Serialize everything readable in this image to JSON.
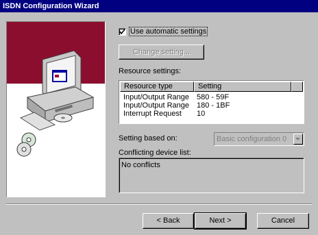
{
  "window": {
    "title": "ISDN Configuration Wizard"
  },
  "options": {
    "use_automatic": {
      "label": "Use automatic settings",
      "checked": true
    },
    "change_setting_label": "Change setting..."
  },
  "resources": {
    "section_label": "Resource settings:",
    "columns": [
      "Resource type",
      "Setting"
    ],
    "rows": [
      [
        "Input/Output Range",
        "580 - 59F"
      ],
      [
        "Input/Output Range",
        "180 - 1BF"
      ],
      [
        "Interrupt Request",
        "10"
      ]
    ]
  },
  "based_on": {
    "label": "Setting based on:",
    "value": "Basic configuration 0"
  },
  "conflicts": {
    "label": "Conflicting device list:",
    "text": "No conflicts"
  },
  "buttons": {
    "back": "< Back",
    "next": "Next >",
    "cancel": "Cancel"
  },
  "colors": {
    "titlebar": "#000080",
    "graphic_band": "#8b0e2e",
    "face": "#c0c0c0"
  },
  "icons": [
    "computer-illustration",
    "cd-icon",
    "checkmark-icon",
    "dropdown-arrow-icon"
  ]
}
